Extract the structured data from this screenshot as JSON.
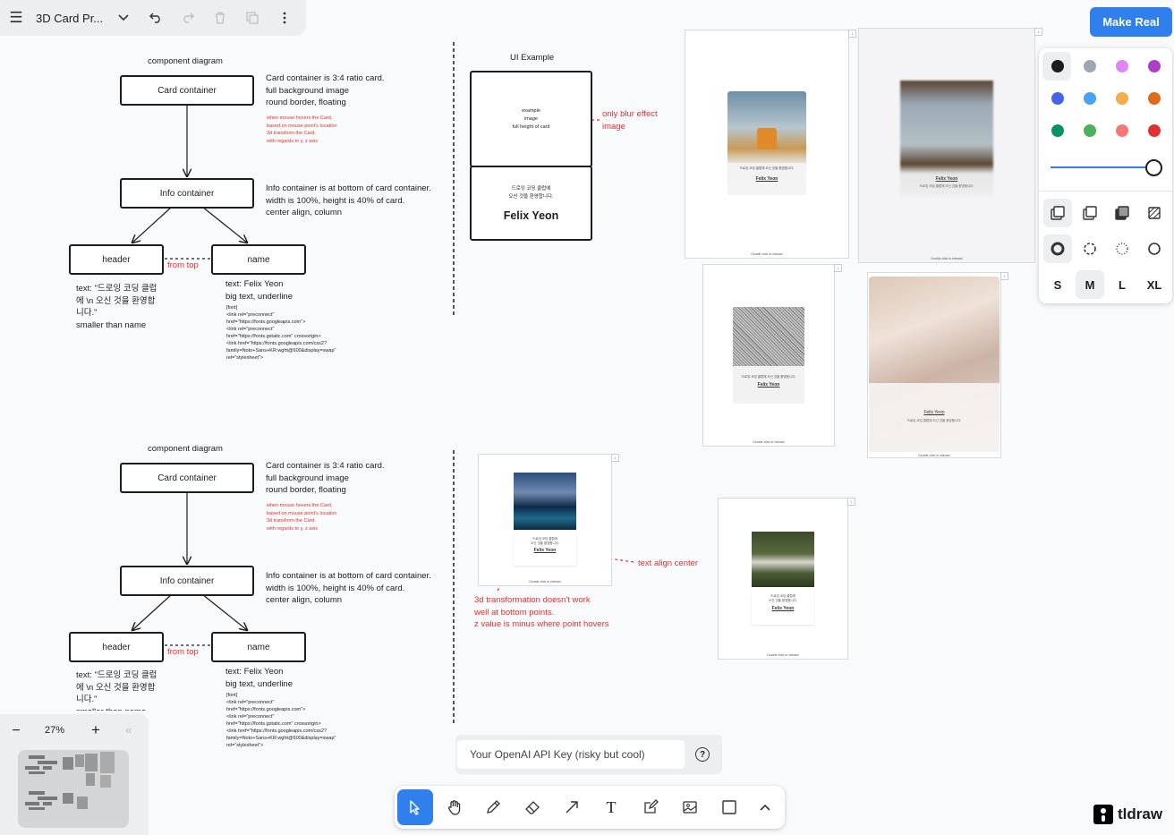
{
  "toolbar_top": {
    "doc_title": "3D Card Pr...",
    "icons": [
      "menu-icon",
      "chevron-down-icon",
      "undo-icon",
      "redo-icon",
      "trash-icon",
      "duplicate-icon",
      "more-icon"
    ]
  },
  "make_real_label": "Make Real",
  "diagram1": {
    "title": "component diagram",
    "card_container": "Card container",
    "card_desc": "Card container is 3:4 ratio card.\nfull background image\nround border, floating",
    "card_hover": "when mouse hovers the Card,\nbased on mouse point's location\n3d transform the Card.\nwith regards to y, z axis",
    "info_container": "Info container",
    "info_desc": "Info container is at bottom of card container.\nwidth is 100%, height is 40% of card.\ncenter align, column",
    "header": "header",
    "name": "name",
    "from_top": "from top",
    "header_text": "text: \"드로잉 코딩 클럽\n에 \\n 오신 것을 환영합\n니다.\"\nsmaller than name",
    "name_text": "text: Felix Yeon\nbig text, underline",
    "font_text": "[font]\n<link rel=\"preconnect\"\nhref=\"https://fonts.googleapis.com\">\n<link rel=\"preconnect\"\nhref=\"https://fonts.gstatic.com\" crossorigin>\n<link href=\"https://fonts.googleapis.com/css2?\nfamily=Noto+Sans+KR:wght@600&display=swap\"\nrel=\"stylesheet\">"
  },
  "diagram2": {
    "title": "component diagram",
    "card_container": "Card container",
    "card_desc": "Card container is 3:4 ratio card.\nfull background image\nround border, floating",
    "card_hover": "when mouse hovers the Card,\nbased on mouse point's location\n3d transform the Card.\nwith regards to y, z axis",
    "info_container": "Info container",
    "info_desc": "Info container is at bottom of card container.\nwidth is 100%, height is 40% of card.\ncenter align, column",
    "header": "header",
    "name": "name",
    "from_top": "from top",
    "header_text": "text: \"드로잉 코딩 클럽\n에 \\n 오신 것을 환영합\n니다.\"\nsmaller than name",
    "name_text": "text: Felix Yeon\nbig text, underline",
    "font_text": "[font]\n<link rel=\"preconnect\"\nhref=\"https://fonts.googleapis.com\">\n<link rel=\"preconnect\"\nhref=\"https://fonts.gstatic.com\" crossorigin>\n<link href=\"https://fonts.googleapis.com/css2?\nfamily=Noto+Sans+KR:wght@600&display=swap\"\nrel=\"stylesheet\">"
  },
  "ui_example": {
    "title": "UI Example",
    "image_text": "example\nimage\nfull height of card",
    "blur_note": "only blur effect\nimage",
    "korean": "드로잉 코딩 클럽에\n오신 것을 환영합니다.",
    "name": "Felix Yeon"
  },
  "notes": {
    "text_align": "text align center",
    "transform_note": "3d transformation doesn't work\nwell at bottom points.\nz value is minus where point hovers"
  },
  "previews": {
    "caption": "Double click to interact",
    "card_name": "Felix Yeon",
    "card_korean": "드로잉 코딩 클럽에 오신 것을 환영합니다.",
    "card_korean_short": "드로잉 코딩 클럽에\n오신 것을 환영합니다.",
    "frame_number": "1"
  },
  "style_panel": {
    "colors": [
      "#1d1d1d",
      "#9fa8b2",
      "#e085f4",
      "#ae3ec9",
      "#4465e9",
      "#4ba1f1",
      "#f1ac4b",
      "#e16919",
      "#099268",
      "#4cb05e",
      "#f87777",
      "#e03131"
    ],
    "opacity": 1.0,
    "sizes": [
      "S",
      "M",
      "L",
      "XL"
    ],
    "selected_size": "M"
  },
  "api_key": {
    "placeholder": "Your OpenAI API Key (risky but cool)",
    "help": "?"
  },
  "zoom": {
    "minus": "−",
    "level": "27%",
    "plus": "+",
    "collapse": "«"
  },
  "tools": [
    "select-tool",
    "hand-tool",
    "draw-tool",
    "eraser-tool",
    "arrow-tool",
    "text-tool",
    "note-tool",
    "image-tool",
    "rectangle-tool",
    "more-tools"
  ],
  "brand": "tldraw"
}
